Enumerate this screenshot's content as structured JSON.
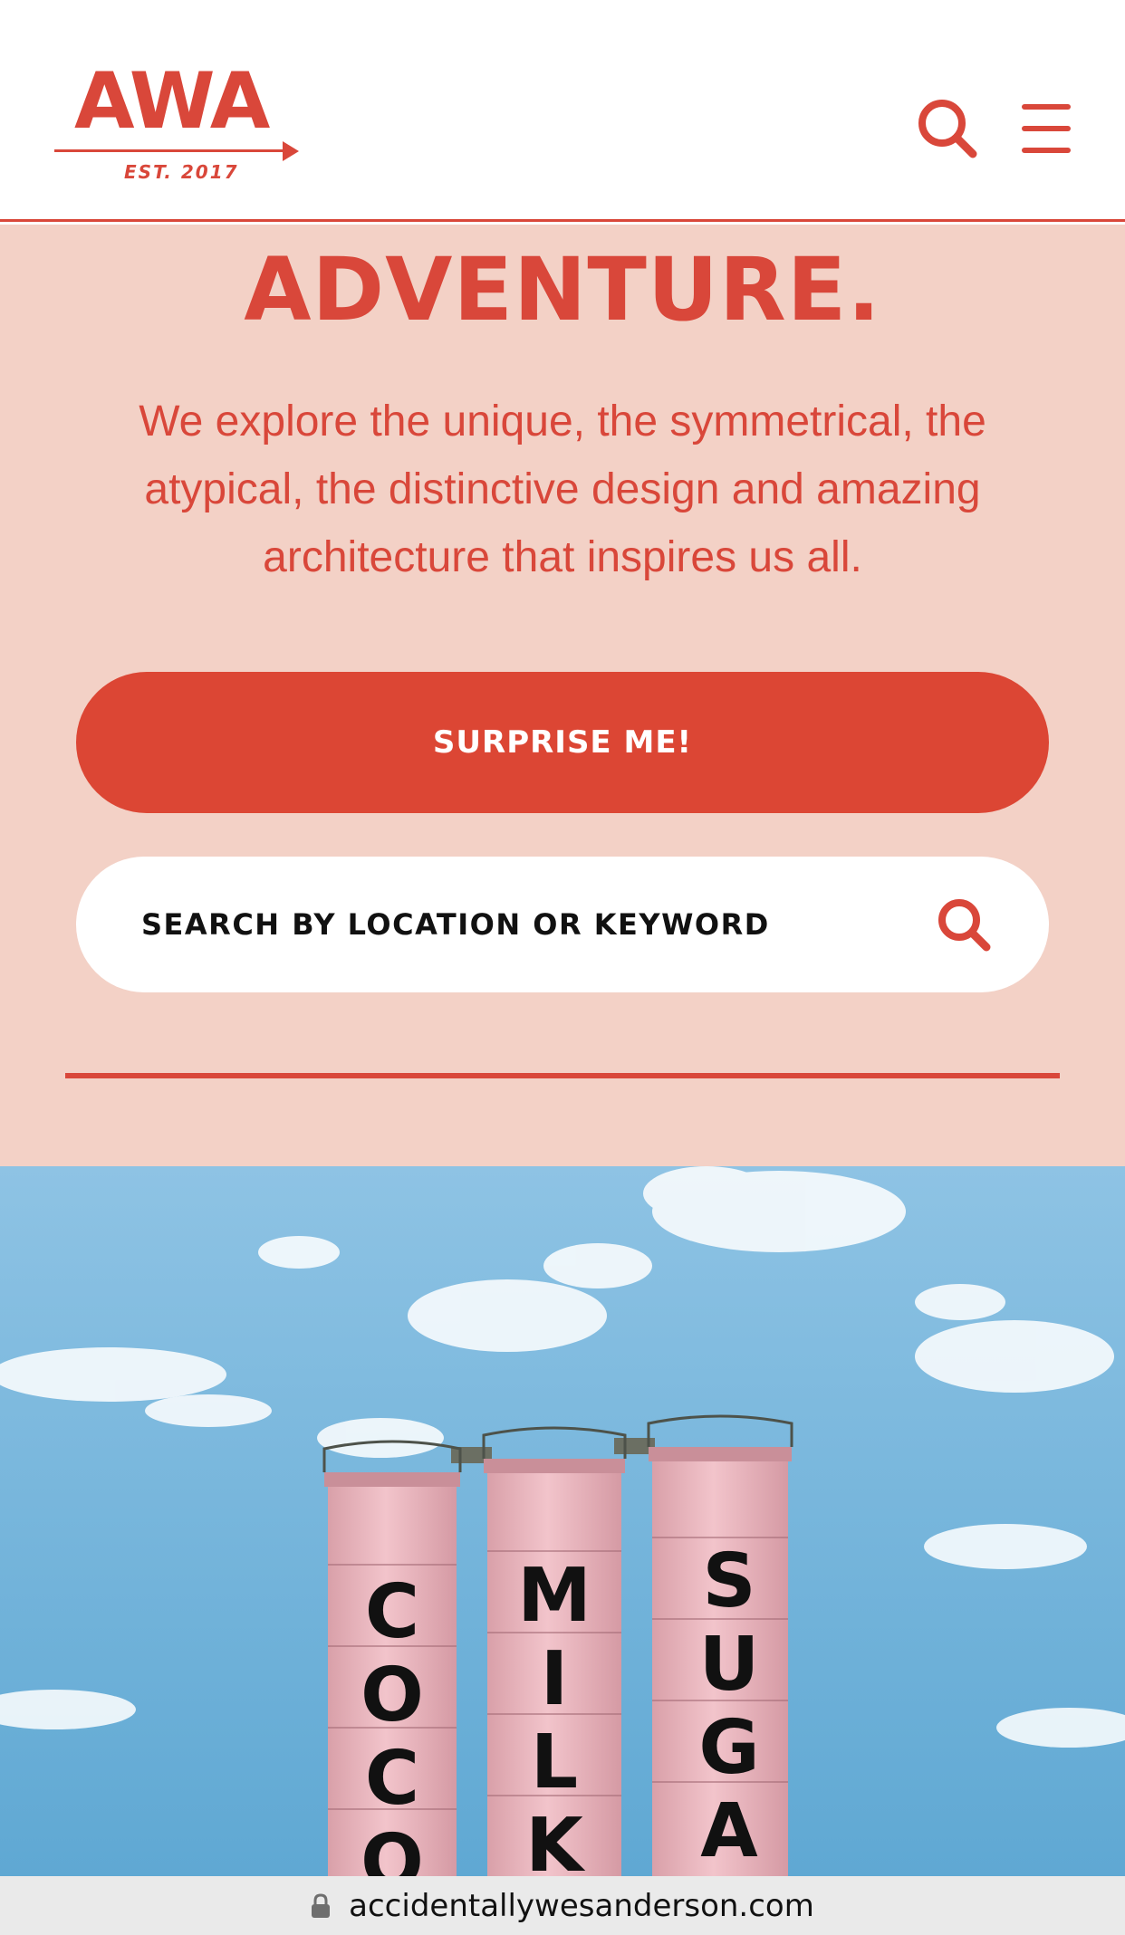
{
  "header": {
    "logo_text": "AWA",
    "logo_est": "EST. 2017",
    "search_icon": "search-icon",
    "menu_icon": "hamburger-menu-icon"
  },
  "hero": {
    "title": "ADVENTURE.",
    "description": "We explore the unique, the symmetrical, the atypical, the distinctive design and amazing architecture that inspires us all.",
    "surprise_button": "SURPRISE ME!",
    "search_placeholder": "SEARCH BY LOCATION OR KEYWORD",
    "search_icon": "search-icon"
  },
  "photo": {
    "silo_labels": [
      "COCO",
      "MILK",
      "SUGA"
    ]
  },
  "browser": {
    "url": "accidentallywesanderson.com",
    "lock_icon": "lock-icon"
  },
  "colors": {
    "accent": "#d9473a",
    "hero_background": "#f3d1c6",
    "button": "#dc4634"
  }
}
